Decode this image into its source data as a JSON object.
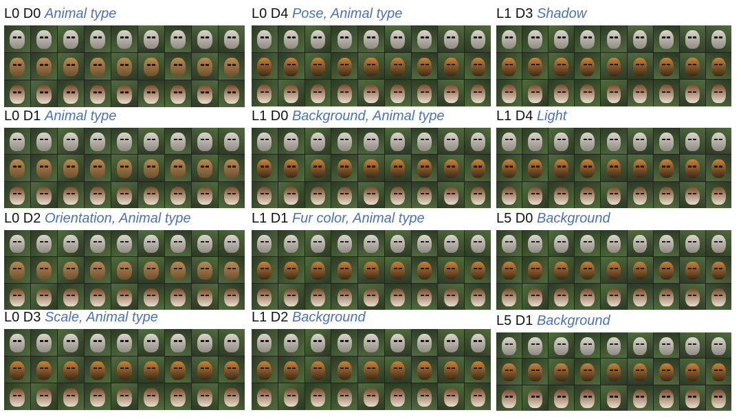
{
  "panels": [
    {
      "id": "L0 D0",
      "desc": "Animal type",
      "rows": [
        "cat",
        "lion",
        "dog"
      ]
    },
    {
      "id": "L0 D1",
      "desc": "Animal type",
      "rows": [
        "cat",
        "lion",
        "dog"
      ]
    },
    {
      "id": "L0 D2",
      "desc": "Orientation, Animal type",
      "rows": [
        "cat",
        "lion",
        "dog"
      ]
    },
    {
      "id": "L0 D3",
      "desc": "Scale, Animal type",
      "rows": [
        "cat",
        "tiger",
        "dog"
      ]
    },
    {
      "id": "L0 D4",
      "desc": "Pose, Animal type",
      "rows": [
        "cat",
        "tiger",
        "dog"
      ]
    },
    {
      "id": "L1 D0",
      "desc": "Background, Animal type",
      "rows": [
        "cat",
        "tiger",
        "dog"
      ]
    },
    {
      "id": "L1 D1",
      "desc": "Fur color, Animal type",
      "rows": [
        "cat",
        "tiger",
        "dog"
      ]
    },
    {
      "id": "L1 D2",
      "desc": "Background",
      "rows": [
        "cat",
        "tiger",
        "dog"
      ]
    },
    {
      "id": "L1 D3",
      "desc": "Shadow",
      "rows": [
        "cat",
        "tiger",
        "dog"
      ]
    },
    {
      "id": "L1 D4",
      "desc": "Light",
      "rows": [
        "cat",
        "tiger",
        "dog"
      ]
    },
    {
      "id": "L5 D0",
      "desc": "Background",
      "rows": [
        "cat",
        "tiger",
        "dog"
      ]
    },
    {
      "id": "L5 D1",
      "desc": "Background",
      "rows": [
        "cat",
        "tiger",
        "dog"
      ]
    }
  ],
  "colors": {
    "label_id": "#111111",
    "label_desc": "#4a72b8",
    "cat": [
      "#d9d4cc",
      "#8f8a82"
    ],
    "lion": [
      "#b88a52",
      "#6e5130"
    ],
    "tiger": [
      "#c9823a",
      "#3b2a17"
    ],
    "dog": [
      "#7a4a2a",
      "#e8ddd0"
    ],
    "background": [
      "#4f6b3c",
      "#2c3a24"
    ]
  }
}
